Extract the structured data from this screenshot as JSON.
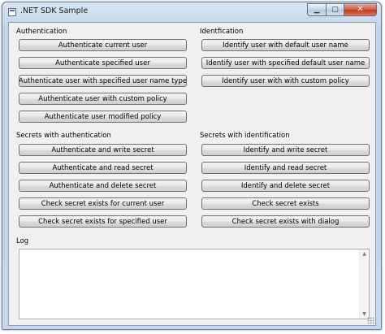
{
  "window": {
    "title": ".NET SDK Sample",
    "controls": {
      "minimize": "▁",
      "maximize": "▢",
      "close": "✕"
    }
  },
  "authentication": {
    "label": "Authentication",
    "buttons": [
      "Authenticate current user",
      "Authenticate specified user",
      "Authenticate user with specified user name type",
      "Authenticate user with custom policy",
      "Authenticate user modified policy"
    ]
  },
  "identification": {
    "label": "Identfication",
    "buttons": [
      "Identify user with default user name",
      "Identify user with specified default user name",
      "Identify user with with custom policy"
    ]
  },
  "secrets_auth": {
    "label": "Secrets with authentication",
    "buttons": [
      "Authenticate and write secret",
      "Authenticate and read secret",
      "Authenticate and delete secret",
      "Check secret exists for current user",
      "Check secret exists for specified user"
    ]
  },
  "secrets_ident": {
    "label": "Secrets with identification",
    "buttons": [
      "Identify and write secret",
      "Identify and read secret",
      "Identify and delete secret",
      "Check secret exists",
      "Check secret exists with dialog"
    ]
  },
  "log": {
    "label": "Log",
    "scroll_up": "▲",
    "scroll_down": "▼"
  }
}
